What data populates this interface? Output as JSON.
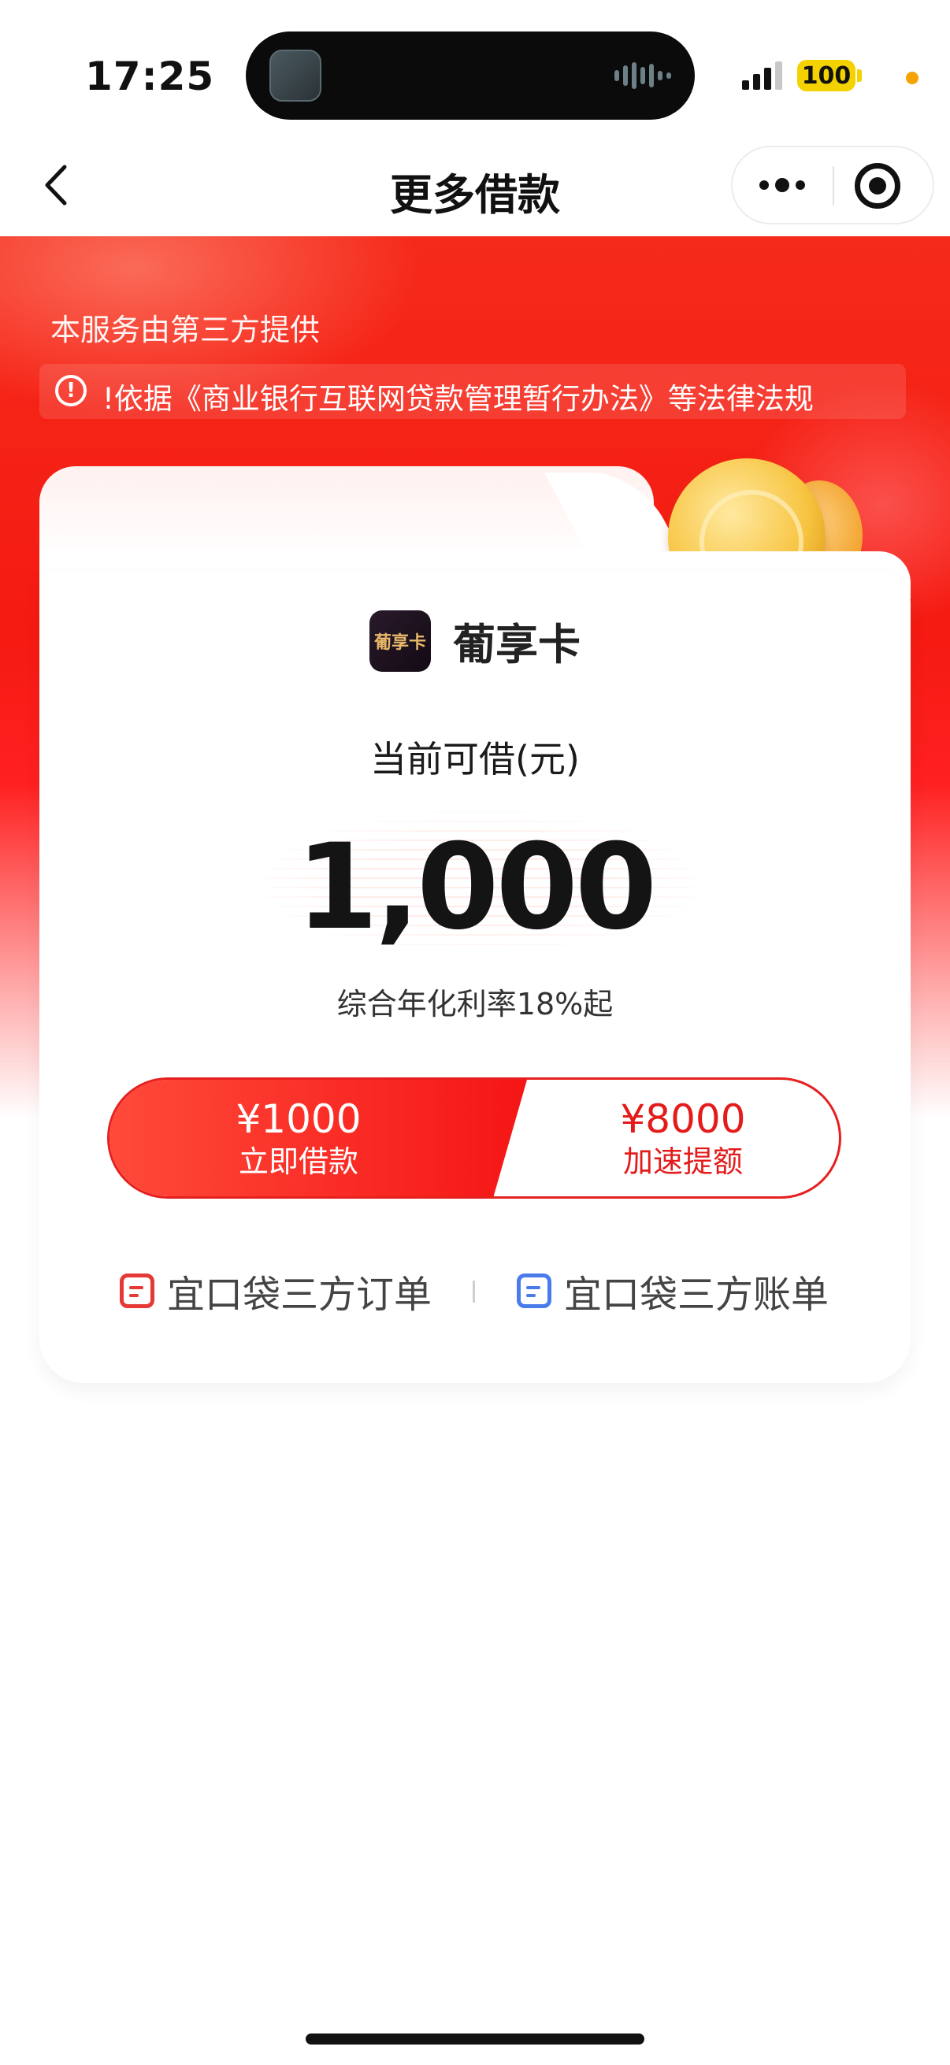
{
  "status_bar": {
    "time": "17:25",
    "battery": "100",
    "colors": {
      "battery": "#f3d200",
      "mic_indicator": "#f5a300"
    }
  },
  "nav": {
    "title": "更多借款",
    "back_icon": "chevron-left-icon",
    "more_icon": "more-dots-icon",
    "close_icon": "target-close-icon"
  },
  "hero": {
    "service_note": "本服务由第三方提供",
    "notice_text": "!依据《商业银行互联网贷款管理暂行办法》等法律法规",
    "notice_icon": "info-circle-icon",
    "colors": {
      "primary_red": "#f51a12",
      "accent_red": "#e61f1f"
    }
  },
  "card": {
    "product_logo_text": "葡享卡",
    "product_name": "葡享卡",
    "available_label": "当前可借(元)",
    "available_amount": "1,000",
    "rate_text": "综合年化利率18%起",
    "borrow_button": {
      "amount": "¥1000",
      "label": "立即借款"
    },
    "boost_button": {
      "amount": "¥8000",
      "label": "加速提额"
    },
    "links": {
      "orders": "宜口袋三方订单",
      "bills": "宜口袋三方账单",
      "orders_icon": "document-icon",
      "bills_icon": "document-icon"
    }
  }
}
